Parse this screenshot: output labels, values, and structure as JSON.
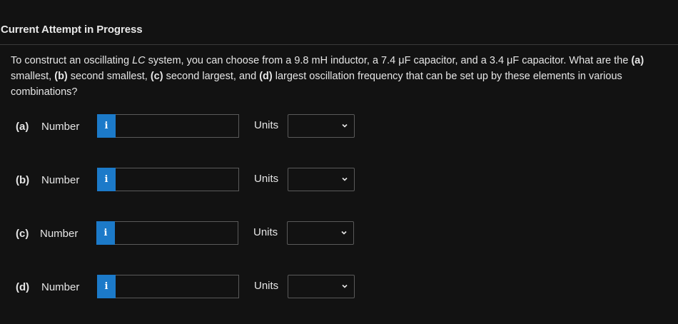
{
  "header": {
    "title": "Current Attempt in Progress"
  },
  "question": {
    "t1": "To construct an oscillating ",
    "t2": "LC",
    "t3": " system, you can choose from a 9.8 mH inductor, a 7.4 μF capacitor, and a 3.4 μF capacitor. What are the ",
    "t4": "(a)",
    "t5": " smallest, ",
    "t6": "(b)",
    "t7": " second smallest, ",
    "t8": "(c)",
    "t9": " second largest, and ",
    "t10": "(d)",
    "t11": " largest oscillation frequency that can be set up by these elements in various combinations?"
  },
  "parts": [
    {
      "label": "(a)",
      "number_label": "Number",
      "info_icon": "i",
      "value": "",
      "units_label": "Units",
      "units_value": ""
    },
    {
      "label": "(b)",
      "number_label": "Number",
      "info_icon": "i",
      "value": "",
      "units_label": "Units",
      "units_value": ""
    },
    {
      "label": "(c)",
      "number_label": "Number",
      "info_icon": "i",
      "value": "",
      "units_label": "Units",
      "units_value": ""
    },
    {
      "label": "(d)",
      "number_label": "Number",
      "info_icon": "i",
      "value": "",
      "units_label": "Units",
      "units_value": ""
    }
  ],
  "colors": {
    "background": "#121212",
    "info_button": "#1c7ac9",
    "input_border": "#5a5a5a",
    "text": "#e6e6e6"
  }
}
